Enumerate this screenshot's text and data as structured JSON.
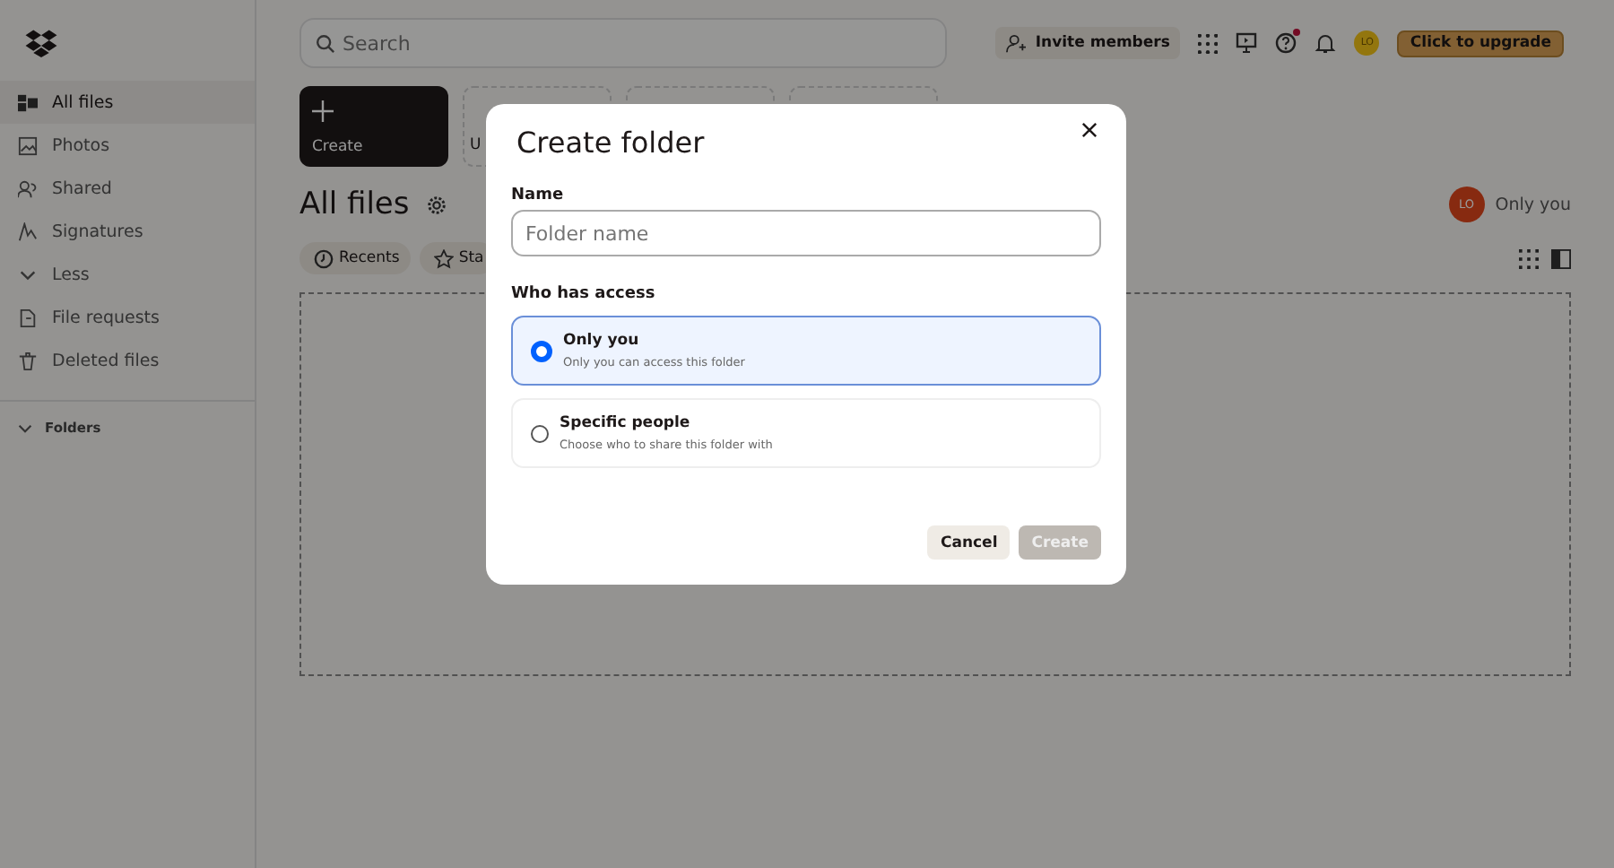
{
  "sidebar": {
    "items": [
      {
        "label": "All files",
        "kind": "files",
        "selected": true
      },
      {
        "label": "Photos",
        "kind": "photo",
        "selected": false
      },
      {
        "label": "Shared",
        "kind": "shared",
        "selected": false
      },
      {
        "label": "Signatures",
        "kind": "sign",
        "selected": false
      },
      {
        "label": "Less",
        "kind": "chevron",
        "selected": false
      },
      {
        "label": "File requests",
        "kind": "request",
        "selected": false
      },
      {
        "label": "Deleted files",
        "kind": "trash",
        "selected": false
      }
    ],
    "folders": {
      "label": "Folders",
      "expanded": true
    }
  },
  "topbar": {
    "search": {
      "placeholder": "Search"
    },
    "invite": "Invite members",
    "avatar": "LO",
    "help_notification": true,
    "upgrade": "Click to upgrade"
  },
  "tiles": [
    {
      "kind": "create",
      "label": "Create"
    },
    {
      "kind": "upload",
      "label": "U"
    },
    {
      "kind": "blank"
    },
    {
      "kind": "blank"
    }
  ],
  "heading": {
    "title": "All files",
    "avatar": "LO",
    "sharing": "Only you"
  },
  "chips": [
    {
      "label": "Recents",
      "kind": "clock"
    },
    {
      "label": "Sta",
      "kind": "star"
    }
  ],
  "dialog": {
    "title": "Create folder",
    "name_label": "Name",
    "name_placeholder": "Folder name",
    "access_label": "Who has access",
    "options": [
      {
        "title": "Only you",
        "description": "Only you can access this folder",
        "selected": true
      },
      {
        "title": "Specific people",
        "description": "Choose who to share this folder with",
        "selected": false
      }
    ],
    "cancel": "Cancel",
    "create": {
      "label": "Create",
      "disabled": true
    }
  }
}
